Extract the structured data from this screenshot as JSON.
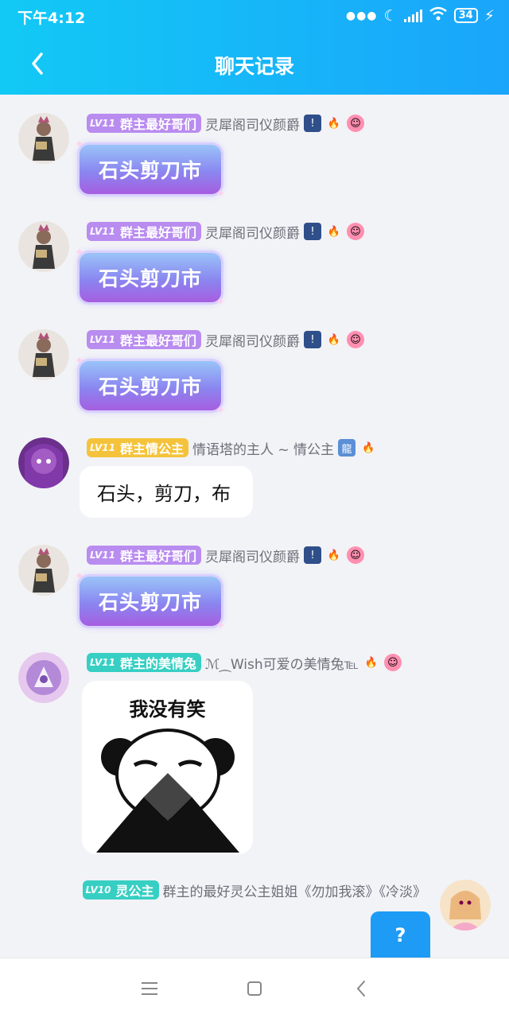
{
  "status": {
    "time": "下午4:12",
    "battery": "34"
  },
  "header": {
    "title": "聊天记录"
  },
  "colors": {
    "header_start": "#12c9f5",
    "header_end": "#1aa5fb",
    "lv_purple": "#b98cf0",
    "lv_yellow": "#f5c33b",
    "lv_teal": "#37cfc3"
  },
  "messages": [
    {
      "level": "LV11",
      "title": "群主最好哥们",
      "nick": "灵犀阁司仪颜爵",
      "text": "石头剪刀市"
    },
    {
      "level": "LV11",
      "title": "群主最好哥们",
      "nick": "灵犀阁司仪颜爵",
      "text": "石头剪刀市"
    },
    {
      "level": "LV11",
      "title": "群主最好哥们",
      "nick": "灵犀阁司仪颜爵",
      "text": "石头剪刀市"
    },
    {
      "level": "LV11",
      "title": "群主情公主",
      "nick": "情语塔的主人 ~ 情公主",
      "text": "石头，剪刀，布"
    },
    {
      "level": "LV11",
      "title": "群主最好哥们",
      "nick": "灵犀阁司仪颜爵",
      "text": "石头剪刀市"
    },
    {
      "level": "LV11",
      "title": "群主的美情兔",
      "nick": "ℳ⁔Wish可爱の美情兔℡",
      "sticker_text": "我没有笑"
    },
    {
      "level": "LV10",
      "title": "灵公主",
      "nick": "群主的最好灵公主姐姐《勿加我滚》《冷淡》"
    }
  ],
  "help_button": "?"
}
